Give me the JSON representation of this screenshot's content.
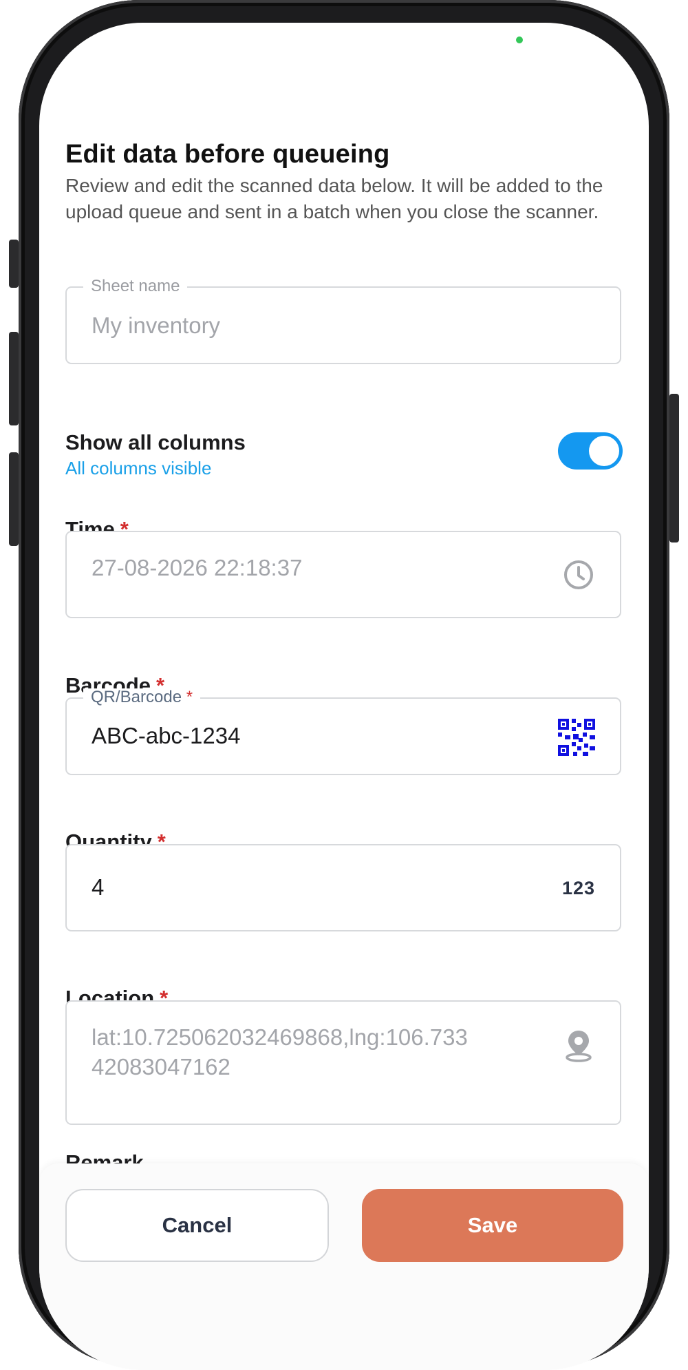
{
  "header": {
    "title": "Edit data before queueing",
    "subtitle": "Review and edit the scanned data below. It will be added to the upload queue and sent in a batch when you close the scanner."
  },
  "sheet": {
    "legend": "Sheet name",
    "placeholder": "My inventory"
  },
  "toggle": {
    "title": "Show all columns",
    "status": "All columns visible",
    "on": true
  },
  "fields": {
    "time": {
      "label": "Time",
      "required": "*",
      "value": "27-08-2026 22:18:37",
      "icon": "clock-icon"
    },
    "barcode": {
      "label": "Barcode",
      "required": "*",
      "legend": "QR/Barcode",
      "legend_required": "*",
      "value": "ABC-abc-1234",
      "icon": "qr-code-icon"
    },
    "quantity": {
      "label": "Quantity",
      "required": "*",
      "value": "4",
      "icon_text": "123"
    },
    "location": {
      "label": "Location",
      "required": "*",
      "value_line1": "lat:10.725062032469868,lng:106.733",
      "value_line2": "42083047162",
      "icon": "location-pin-icon"
    },
    "remark": {
      "label": "Remark"
    }
  },
  "actions": {
    "cancel_label": "Cancel",
    "save_label": "Save"
  },
  "colors": {
    "accent": "#1498f0",
    "save": "#dc7858",
    "required": "#d32f2f",
    "qr_icon": "#1010e0"
  }
}
